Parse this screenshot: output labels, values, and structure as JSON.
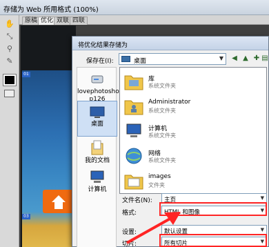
{
  "window": {
    "title": "存储为 Web 所用格式 (100%)"
  },
  "tabs": [
    {
      "label": "原稿",
      "active": false
    },
    {
      "label": "优化",
      "active": true
    },
    {
      "label": "双联",
      "active": false
    },
    {
      "label": "四联",
      "active": false
    }
  ],
  "tools": [
    {
      "icon": "hand-icon"
    },
    {
      "icon": "slice-select-icon"
    },
    {
      "icon": "zoom-icon"
    },
    {
      "icon": "eyedropper-icon"
    }
  ],
  "canvas": {
    "slice_labels": [
      "01",
      "03"
    ]
  },
  "dialog": {
    "title": "将优化结果存储为",
    "save_in_label": "保存在(I):",
    "save_in_value": "桌面",
    "places": [
      {
        "label": "lovephotosho p126",
        "icon": "computer-drive-icon"
      },
      {
        "label": "桌面",
        "icon": "desktop-icon",
        "selected": true
      },
      {
        "label": "我的文档",
        "icon": "documents-icon"
      },
      {
        "label": "计算机",
        "icon": "computer-icon"
      }
    ],
    "files": [
      {
        "name": "库",
        "type": "系统文件夹",
        "icon": "library-folder-icon"
      },
      {
        "name": "Administrator",
        "type": "系统文件夹",
        "icon": "user-folder-icon"
      },
      {
        "name": "计算机",
        "type": "系统文件夹",
        "icon": "computer-icon"
      },
      {
        "name": "网络",
        "type": "系统文件夹",
        "icon": "network-icon"
      },
      {
        "name": "images",
        "type": "文件夹",
        "icon": "folder-icon"
      }
    ],
    "filename_label": "文件名(N):",
    "filename_value": "主页",
    "format_label": "格式:",
    "format_value": "HTML 和图像",
    "settings_label": "设置:",
    "settings_value": "默认设置",
    "slices_label": "切片:",
    "slices_value": "所有切片"
  },
  "colors": {
    "highlight": "#ff2424",
    "accent": "#3a6ea5"
  }
}
